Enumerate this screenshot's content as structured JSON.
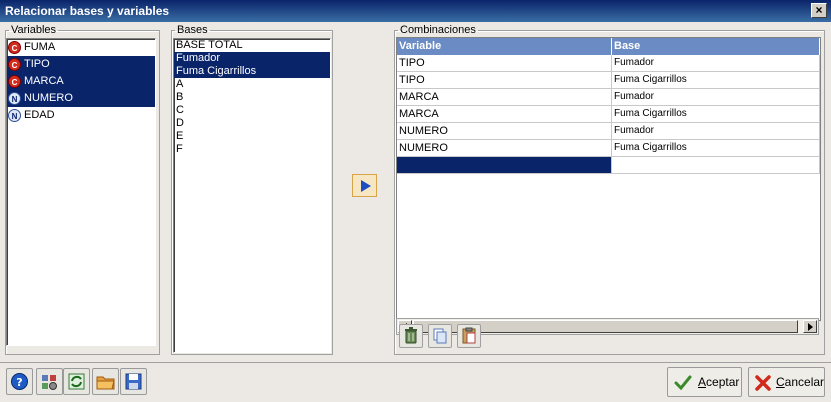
{
  "window": {
    "title": "Relacionar bases y variables"
  },
  "variables": {
    "legend": "Variables",
    "items": [
      {
        "label": "FUMA",
        "type": "C",
        "selected": false
      },
      {
        "label": "TIPO",
        "type": "C",
        "selected": true
      },
      {
        "label": "MARCA",
        "type": "C",
        "selected": true
      },
      {
        "label": "NUMERO",
        "type": "N",
        "selected": true
      },
      {
        "label": "EDAD",
        "type": "N",
        "selected": false
      }
    ]
  },
  "bases": {
    "legend": "Bases",
    "items": [
      {
        "label": "BASE TOTAL",
        "selected": false
      },
      {
        "label": "Fumador",
        "selected": true
      },
      {
        "label": "Fuma Cigarrillos",
        "selected": true
      },
      {
        "label": "A",
        "selected": false
      },
      {
        "label": "B",
        "selected": false
      },
      {
        "label": "C",
        "selected": false
      },
      {
        "label": "D",
        "selected": false
      },
      {
        "label": "E",
        "selected": false
      },
      {
        "label": "F",
        "selected": false
      }
    ]
  },
  "combinaciones": {
    "legend": "Combinaciones",
    "columns": [
      "Variable",
      "Base"
    ],
    "rows": [
      [
        "TIPO",
        "Fumador"
      ],
      [
        "TIPO",
        "Fuma Cigarrillos"
      ],
      [
        "MARCA",
        "Fumador"
      ],
      [
        "MARCA",
        "Fuma Cigarrillos"
      ],
      [
        "NUMERO",
        "Fumador"
      ],
      [
        "NUMERO",
        "Fuma Cigarrillos"
      ]
    ]
  },
  "footer": {
    "accept_prefix": "A",
    "accept_rest": "ceptar",
    "cancel_prefix": "C",
    "cancel_rest": "ancelar"
  },
  "colors": {
    "selection": "#0a246a",
    "grid_header": "#6b8bc4",
    "accent_add": "#1c4fbf"
  }
}
